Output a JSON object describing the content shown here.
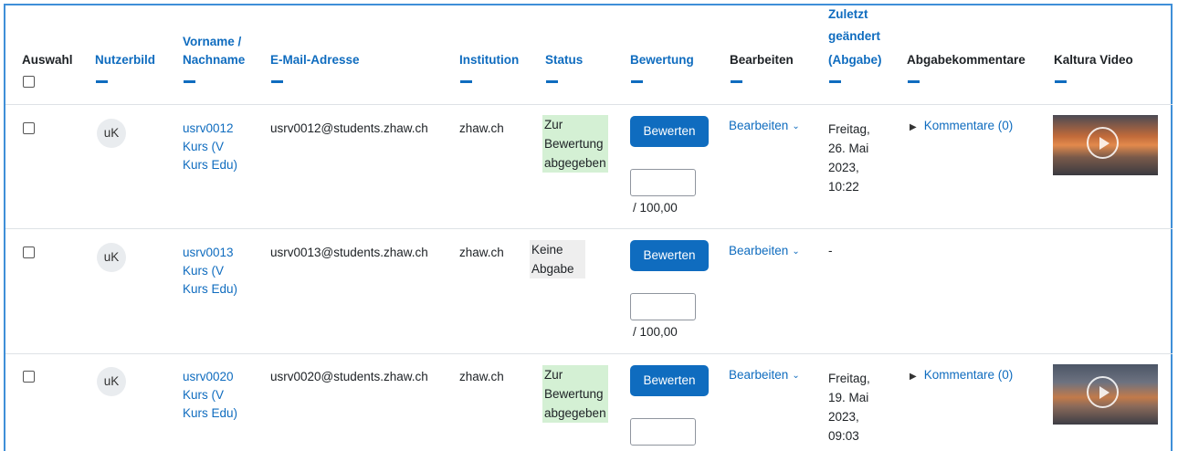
{
  "headers": {
    "auswahl": "Auswahl",
    "nutzerbild": "Nutzerbild",
    "name": [
      "Vorname /",
      "Nachname"
    ],
    "email": "E-Mail-Adresse",
    "institution": "Institution",
    "status": "Status",
    "bewertung": "Bewertung",
    "bearbeiten": "Bearbeiten",
    "geaendert": [
      "Zuletzt",
      "geändert",
      "(Abgabe)"
    ],
    "kommentare": "Abgabekommentare",
    "video": "Kaltura Video"
  },
  "rows": [
    {
      "initials": "uK",
      "name": [
        "usrv0012",
        "Kurs (V",
        "Kurs Edu)"
      ],
      "email": "usrv0012@students.zhaw.ch",
      "institution": "zhaw.ch",
      "status": [
        "Zur",
        "Bewertung",
        "abgegeben"
      ],
      "grade_button": "Bewerten",
      "grade_max": "/ 100,00",
      "edit": "Bearbeiten",
      "modified": [
        "Freitag,",
        "26. Mai",
        "2023,",
        "10:22"
      ],
      "comments": "Kommentare (0)",
      "has_video": true
    },
    {
      "initials": "uK",
      "name": [
        "usrv0013",
        "Kurs (V",
        "Kurs Edu)"
      ],
      "email": "usrv0013@students.zhaw.ch",
      "institution": "zhaw.ch",
      "status": [
        "Keine",
        "Abgabe"
      ],
      "grade_button": "Bewerten",
      "grade_max": "/ 100,00",
      "edit": "Bearbeiten",
      "modified": [
        "-"
      ],
      "comments": "",
      "has_video": false
    },
    {
      "initials": "uK",
      "name": [
        "usrv0020",
        "Kurs (V",
        "Kurs Edu)"
      ],
      "email": "usrv0020@students.zhaw.ch",
      "institution": "zhaw.ch",
      "status": [
        "Zur",
        "Bewertung",
        "abgegeben"
      ],
      "grade_button": "Bewerten",
      "grade_max": "",
      "edit": "Bearbeiten",
      "modified": [
        "Freitag,",
        "19. Mai",
        "2023,",
        "09:03"
      ],
      "comments": "Kommentare (0)",
      "has_video": true
    }
  ],
  "colors": {
    "link": "#0f6cbf",
    "status_submitted_bg": "#d4f0d4",
    "status_none_bg": "#eeeeee",
    "frame": "#3f8fd8"
  }
}
